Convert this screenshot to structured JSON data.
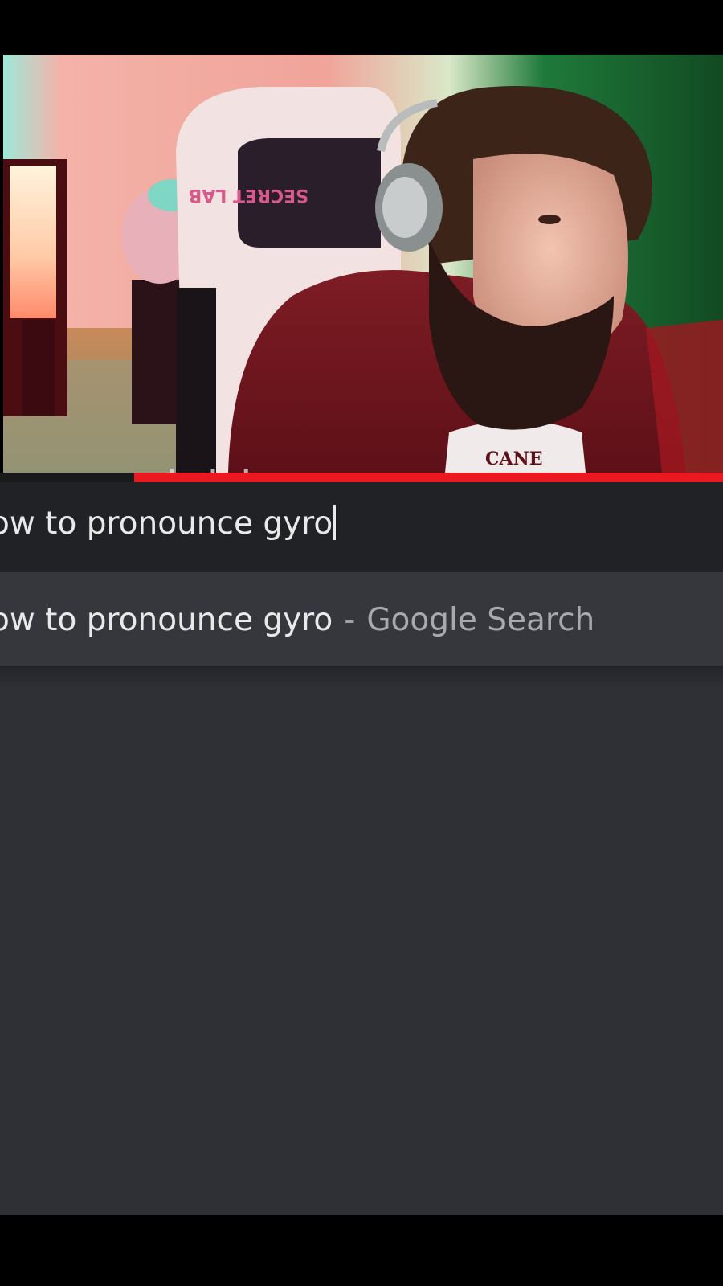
{
  "webcam": {
    "watermark": "yomoghadodo",
    "chair_text": "SECRET LAB",
    "shirt_text": "CANE",
    "video_progress": 0.815
  },
  "address_bar": {
    "value": "ow to pronounce gyro"
  },
  "suggestions": [
    {
      "query": "ow to pronounce gyro",
      "separator": "-",
      "engine": "Google Search"
    }
  ],
  "colors": {
    "address_bar_bg": "#202226",
    "suggestion_bg": "#35373c",
    "content_bg": "#2e3035",
    "progress_red": "#ea1820",
    "text": "#e9e9ea",
    "muted_text": "#a6a9ae"
  }
}
